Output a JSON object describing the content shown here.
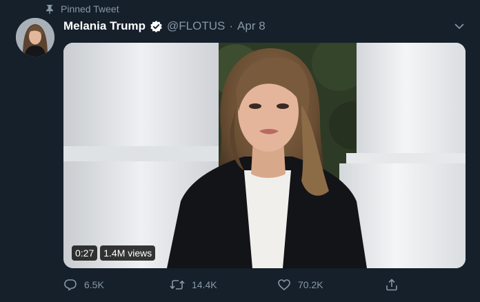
{
  "pinned": {
    "label": "Pinned Tweet",
    "icon": "pin-icon"
  },
  "author": {
    "name": "Melania Trump",
    "handle": "@FLOTUS",
    "separator": "·",
    "date": "Apr 8",
    "verified": true
  },
  "media": {
    "duration": "0:27",
    "views": "1.4M views"
  },
  "actions": {
    "replies": "6.5K",
    "retweets": "14.4K",
    "likes": "70.2K"
  },
  "colors": {
    "background": "#15202b",
    "secondary_text": "#8899a6",
    "primary_text": "#ffffff"
  }
}
